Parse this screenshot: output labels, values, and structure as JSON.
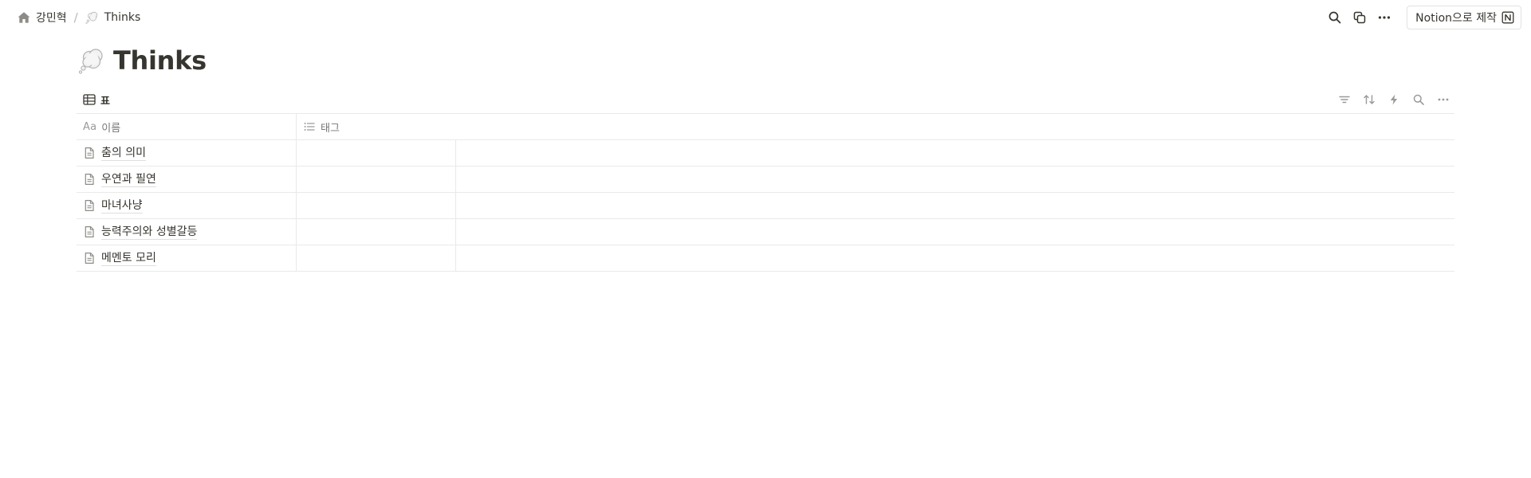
{
  "breadcrumb": {
    "workspace": "강민혁",
    "separator": "/",
    "page": "Thinks"
  },
  "topbar": {
    "notion_button": "Notion으로 제작",
    "icons": [
      "search-icon",
      "duplicate-icon",
      "more-icon",
      "notion-logo"
    ]
  },
  "page": {
    "title": "Thinks",
    "emoji": "thought-balloon"
  },
  "view": {
    "tab_label": "표",
    "tools": [
      "filter-icon",
      "sort-icon",
      "automation-icon",
      "search-icon",
      "more-icon"
    ]
  },
  "table": {
    "columns": [
      {
        "label": "이름",
        "type_icon": "Aa"
      },
      {
        "label": "태그",
        "type_icon": "multi-select-icon"
      }
    ],
    "rows": [
      {
        "title": "춤의 의미"
      },
      {
        "title": "우연과 필연"
      },
      {
        "title": "마녀사냥"
      },
      {
        "title": "능력주의와 성별갈등"
      },
      {
        "title": "메멘토 모리"
      }
    ]
  },
  "colors": {
    "text": "#37352f",
    "muted": "#787774",
    "border": "#e9e9e7"
  }
}
